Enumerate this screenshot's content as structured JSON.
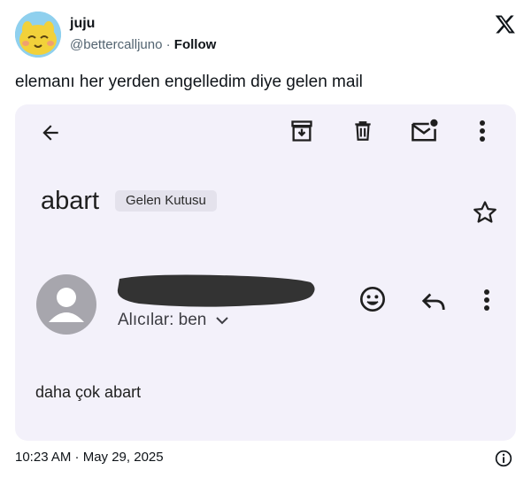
{
  "tweet": {
    "author_name": "juju",
    "handle": "@bettercalljuno",
    "separator": "·",
    "follow_label": "Follow",
    "text": "elemanı her yerden engelledim diye gelen mail",
    "timestamp": "10:23 AM · May 29, 2025"
  },
  "email": {
    "subject": "abart",
    "folder_label": "Gelen Kutusu",
    "recipients_label": "Alıcılar: ben",
    "body": "daha çok abart",
    "toolbar_icons": [
      "back-arrow-icon",
      "archive-icon",
      "delete-icon",
      "mark-unread-icon",
      "more-vert-icon"
    ]
  },
  "colors": {
    "card_background": "#f3f1fa",
    "chip_background": "#e4e2ec",
    "text_primary": "#0f1419",
    "text_secondary": "#536471",
    "icon_color": "#1f1f1f",
    "redaction": "#333333"
  }
}
